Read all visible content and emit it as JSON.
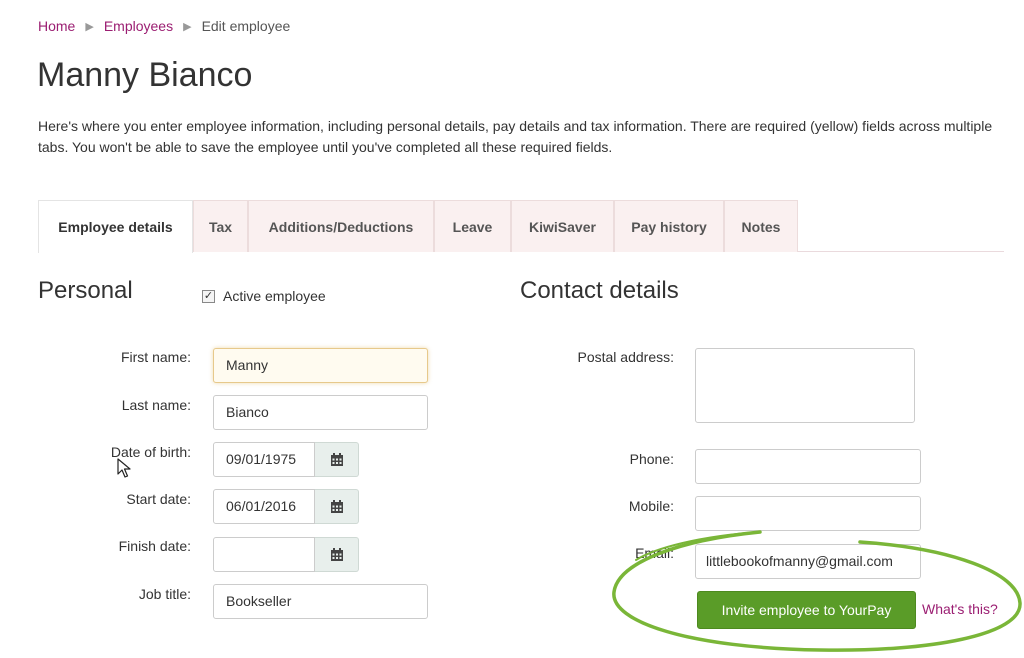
{
  "breadcrumb": {
    "home": "Home",
    "employees": "Employees",
    "current": "Edit employee",
    "separator": "▶"
  },
  "page": {
    "title": "Manny Bianco",
    "intro": "Here's where you enter employee information, including personal details, pay details and tax information. There are required (yellow) fields across multiple tabs. You won't be able to save the employee until you've completed all these required fields."
  },
  "tabs": [
    {
      "label": "Employee details",
      "active": true
    },
    {
      "label": "Tax"
    },
    {
      "label": "Additions/Deductions"
    },
    {
      "label": "Leave"
    },
    {
      "label": "KiwiSaver"
    },
    {
      "label": "Pay history"
    },
    {
      "label": "Notes"
    }
  ],
  "personal": {
    "title": "Personal",
    "active_employee_label": "Active employee",
    "active_employee_checked": true,
    "first_name_label": "First name:",
    "first_name": "Manny",
    "last_name_label": "Last name:",
    "last_name": "Bianco",
    "dob_label": "Date of birth:",
    "dob": "09/01/1975",
    "start_date_label": "Start date:",
    "start_date": "06/01/2016",
    "finish_date_label": "Finish date:",
    "finish_date": "",
    "job_title_label": "Job title:",
    "job_title": "Bookseller"
  },
  "contact": {
    "title": "Contact details",
    "postal_label": "Postal address:",
    "postal_address": "",
    "phone_label": "Phone:",
    "phone": "",
    "mobile_label": "Mobile:",
    "mobile": "",
    "email_label": "Email:",
    "email": "littlebookofmanny@gmail.com",
    "invite_button": "Invite employee to YourPay",
    "whats_this": "What's this?"
  },
  "colors": {
    "link": "#9b1e72",
    "invite_button": "#5a9c28",
    "highlight_ellipse": "#7ab638",
    "required_field_border": "#e7c98b"
  },
  "icons": {
    "date_button": "calendar-icon",
    "cursor": "mouse-pointer-icon"
  }
}
